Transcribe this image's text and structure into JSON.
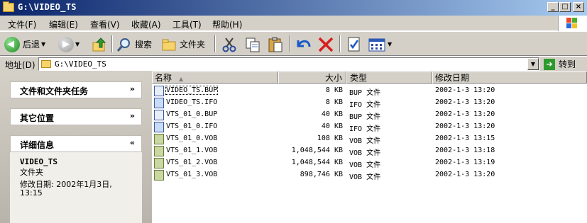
{
  "window": {
    "title": "G:\\VIDEO_TS"
  },
  "menu": [
    "文件(F)",
    "编辑(E)",
    "查看(V)",
    "收藏(A)",
    "工具(T)",
    "帮助(H)"
  ],
  "toolbar": {
    "back_label": "后退",
    "search_label": "搜索",
    "folders_label": "文件夹"
  },
  "address": {
    "label": "地址(D)",
    "value": "G:\\VIDEO_TS",
    "go_label": "转到"
  },
  "taskpane": {
    "file_tasks": "文件和文件夹任务",
    "other_places": "其它位置",
    "details": "详细信息",
    "detail_name": "VIDEO_TS",
    "detail_type": "文件夹",
    "detail_modified_1": "修改日期: 2002年1月3日,",
    "detail_modified_2": "13:15"
  },
  "columns": {
    "name": "名称",
    "size": "大小",
    "type": "类型",
    "date": "修改日期"
  },
  "files": [
    {
      "name": "VIDEO_TS.BUP",
      "size": "8 KB",
      "type": "BUP 文件",
      "date": "2002-1-3 13:20",
      "icon": "bup"
    },
    {
      "name": "VIDEO_TS.IFO",
      "size": "8 KB",
      "type": "IFO 文件",
      "date": "2002-1-3 13:20",
      "icon": "ifo"
    },
    {
      "name": "VTS_01_0.BUP",
      "size": "40 KB",
      "type": "BUP 文件",
      "date": "2002-1-3 13:20",
      "icon": "bup"
    },
    {
      "name": "VTS_01_0.IFO",
      "size": "40 KB",
      "type": "IFO 文件",
      "date": "2002-1-3 13:20",
      "icon": "ifo"
    },
    {
      "name": "VTS_01_0.VOB",
      "size": "108 KB",
      "type": "VOB 文件",
      "date": "2002-1-3 13:15",
      "icon": "vob"
    },
    {
      "name": "VTS_01_1.VOB",
      "size": "1,048,544 KB",
      "type": "VOB 文件",
      "date": "2002-1-3 13:18",
      "icon": "vob"
    },
    {
      "name": "VTS_01_2.VOB",
      "size": "1,048,544 KB",
      "type": "VOB 文件",
      "date": "2002-1-3 13:19",
      "icon": "vob"
    },
    {
      "name": "VTS_01_3.VOB",
      "size": "898,746 KB",
      "type": "VOB 文件",
      "date": "2002-1-3 13:20",
      "icon": "vob"
    }
  ]
}
